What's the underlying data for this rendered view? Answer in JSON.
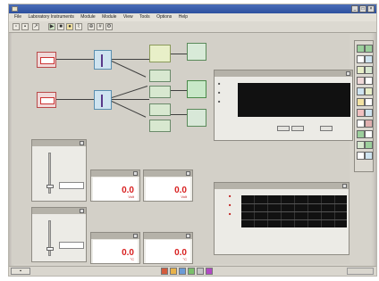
{
  "window": {
    "title": "",
    "menu": [
      "File",
      "Laboratory Instruments",
      "Module",
      "Module",
      "View",
      "Tools",
      "Options",
      "Help"
    ]
  },
  "readouts": [
    {
      "value": "0.0",
      "unit": "Volt"
    },
    {
      "value": "0.0",
      "unit": "Volt"
    },
    {
      "value": "0.0",
      "unit": "°C"
    },
    {
      "value": "0.0",
      "unit": "°C"
    }
  ],
  "colors": {
    "accent_red": "#d81f1f",
    "scope_bg": "#111111",
    "title_blue": "#2c4f9e"
  }
}
